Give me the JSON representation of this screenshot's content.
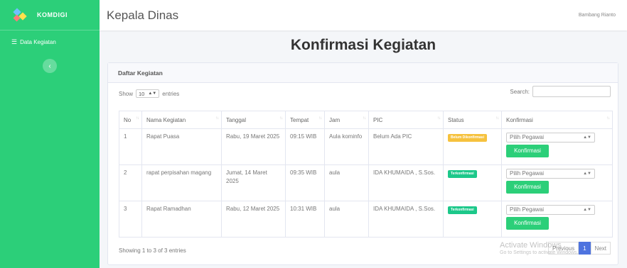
{
  "brand": {
    "name": "KOMDIGI"
  },
  "sidebar": {
    "items": [
      {
        "label": "Data Kegiatan"
      }
    ]
  },
  "topbar": {
    "title": "Kepala Dinas",
    "user": "Bambang Rianto"
  },
  "page": {
    "heading": "Konfirmasi Kegiatan"
  },
  "card": {
    "title": "Daftar Kegiatan"
  },
  "table_controls": {
    "show_label": "Show",
    "length_value": "10",
    "entries_label": "entries",
    "search_label": "Search:"
  },
  "table": {
    "headers": [
      "No",
      "Nama Kegiatan",
      "Tanggal",
      "Tempat",
      "Jam",
      "PIC",
      "Status",
      "Konfirmasi"
    ],
    "rows": [
      {
        "no": "1",
        "nama": "Rapat Puasa",
        "tanggal": "Rabu, 19 Maret 2025",
        "tempat": "09:15 WIB",
        "jam": "Aula kominfo",
        "pic": "Belum Ada PIC",
        "status": "Belum Dikonfirmasi",
        "status_type": "warning",
        "select": "Pilih Pegawai",
        "button": "Konfirmasi"
      },
      {
        "no": "2",
        "nama": "rapat perpisahan magang",
        "tanggal": "Jumat, 14 Maret 2025",
        "tempat": "09:35 WIB",
        "jam": "aula",
        "pic": "IDA KHUMAIDA , S.Sos.",
        "status": "Terkonfirmasi",
        "status_type": "success",
        "select": "Pilih Pegawai",
        "button": "Konfirmasi"
      },
      {
        "no": "3",
        "nama": "Rapat Ramadhan",
        "tanggal": "Rabu, 12 Maret 2025",
        "tempat": "10:31 WIB",
        "jam": "aula",
        "pic": "IDA KHUMAIDA , S.Sos.",
        "status": "Terkonfirmasi",
        "status_type": "success",
        "select": "Pilih Pegawai",
        "button": "Konfirmasi"
      }
    ]
  },
  "footer": {
    "info": "Showing 1 to 3 of 3 entries",
    "previous": "Previous",
    "page": "1",
    "next": "Next"
  },
  "watermark": {
    "line1": "Activate Windows",
    "line2": "Go to Settings to activate Windows."
  },
  "colors": {
    "sidebar": "#2ccf79",
    "warning": "#f6c23e",
    "success": "#1cc88a",
    "pager_active": "#4e73df"
  }
}
